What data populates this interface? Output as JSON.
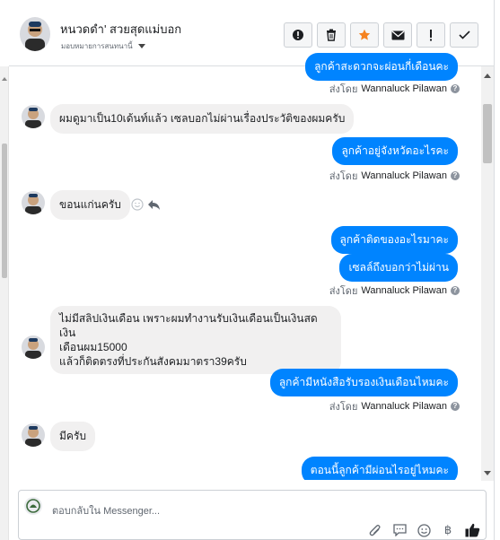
{
  "header": {
    "contact_name": "หนวดดำ' สวยสุดแม่บอก",
    "assign_label": "มอบหมายการสนทนานี้",
    "actions": [
      {
        "name": "mark-spam",
        "icon": "exclamation-circle-icon"
      },
      {
        "name": "delete",
        "icon": "trash-icon"
      },
      {
        "name": "star",
        "icon": "star-icon"
      },
      {
        "name": "mark-unread",
        "icon": "envelope-icon"
      },
      {
        "name": "follow-up",
        "icon": "exclamation-icon"
      },
      {
        "name": "done",
        "icon": "check-icon"
      }
    ],
    "colors": {
      "star_active": "#f5821f"
    }
  },
  "messages": {
    "top_partial_text": "ลูกค้าสะดวกจะผ่อนกี่เดือนคะ",
    "m1_in": "ผมดูมาเป็น10เด้นท์แล้ว เซลบอกไม่ผ่านเรื่องประวัติของผมครับ",
    "m2_out": "ลูกค้าอยู่จังหวัดอะไรคะ",
    "m3_in": "ขอนแก่นครับ",
    "m4_out": "ลูกค้าติดของอะไรมาคะ",
    "m5_out": "เซลล์ถึงบอกว่าไม่ผ่าน",
    "m6_in_line1": "ไม่มีสลิปเงินเดือน เพราะผมทำงานรับเงินเดือนเป็นเงินสด เงิน",
    "m6_in_line2": "เดือนผม15000",
    "m6_in_line3": "แล้วก็ติดตรงที่ประกันสังคมมาตรา39ครับ",
    "m7_out": "ลูกค้ามีหนังสือรับรองเงินเดือนไหมคะ",
    "m8_in": "มีครับ",
    "m9_out": "ตอนนี้ลูกค้ามีผ่อนไรอยู่ไหมคะ",
    "sent_by_prefix": "ส่งโดย",
    "sent_by_name": "Wannaluck Pilawan",
    "colors": {
      "outgoing": "#0084ff",
      "incoming": "#f1f0f0"
    }
  },
  "composer": {
    "placeholder": "ตอบกลับใน Messenger..."
  }
}
